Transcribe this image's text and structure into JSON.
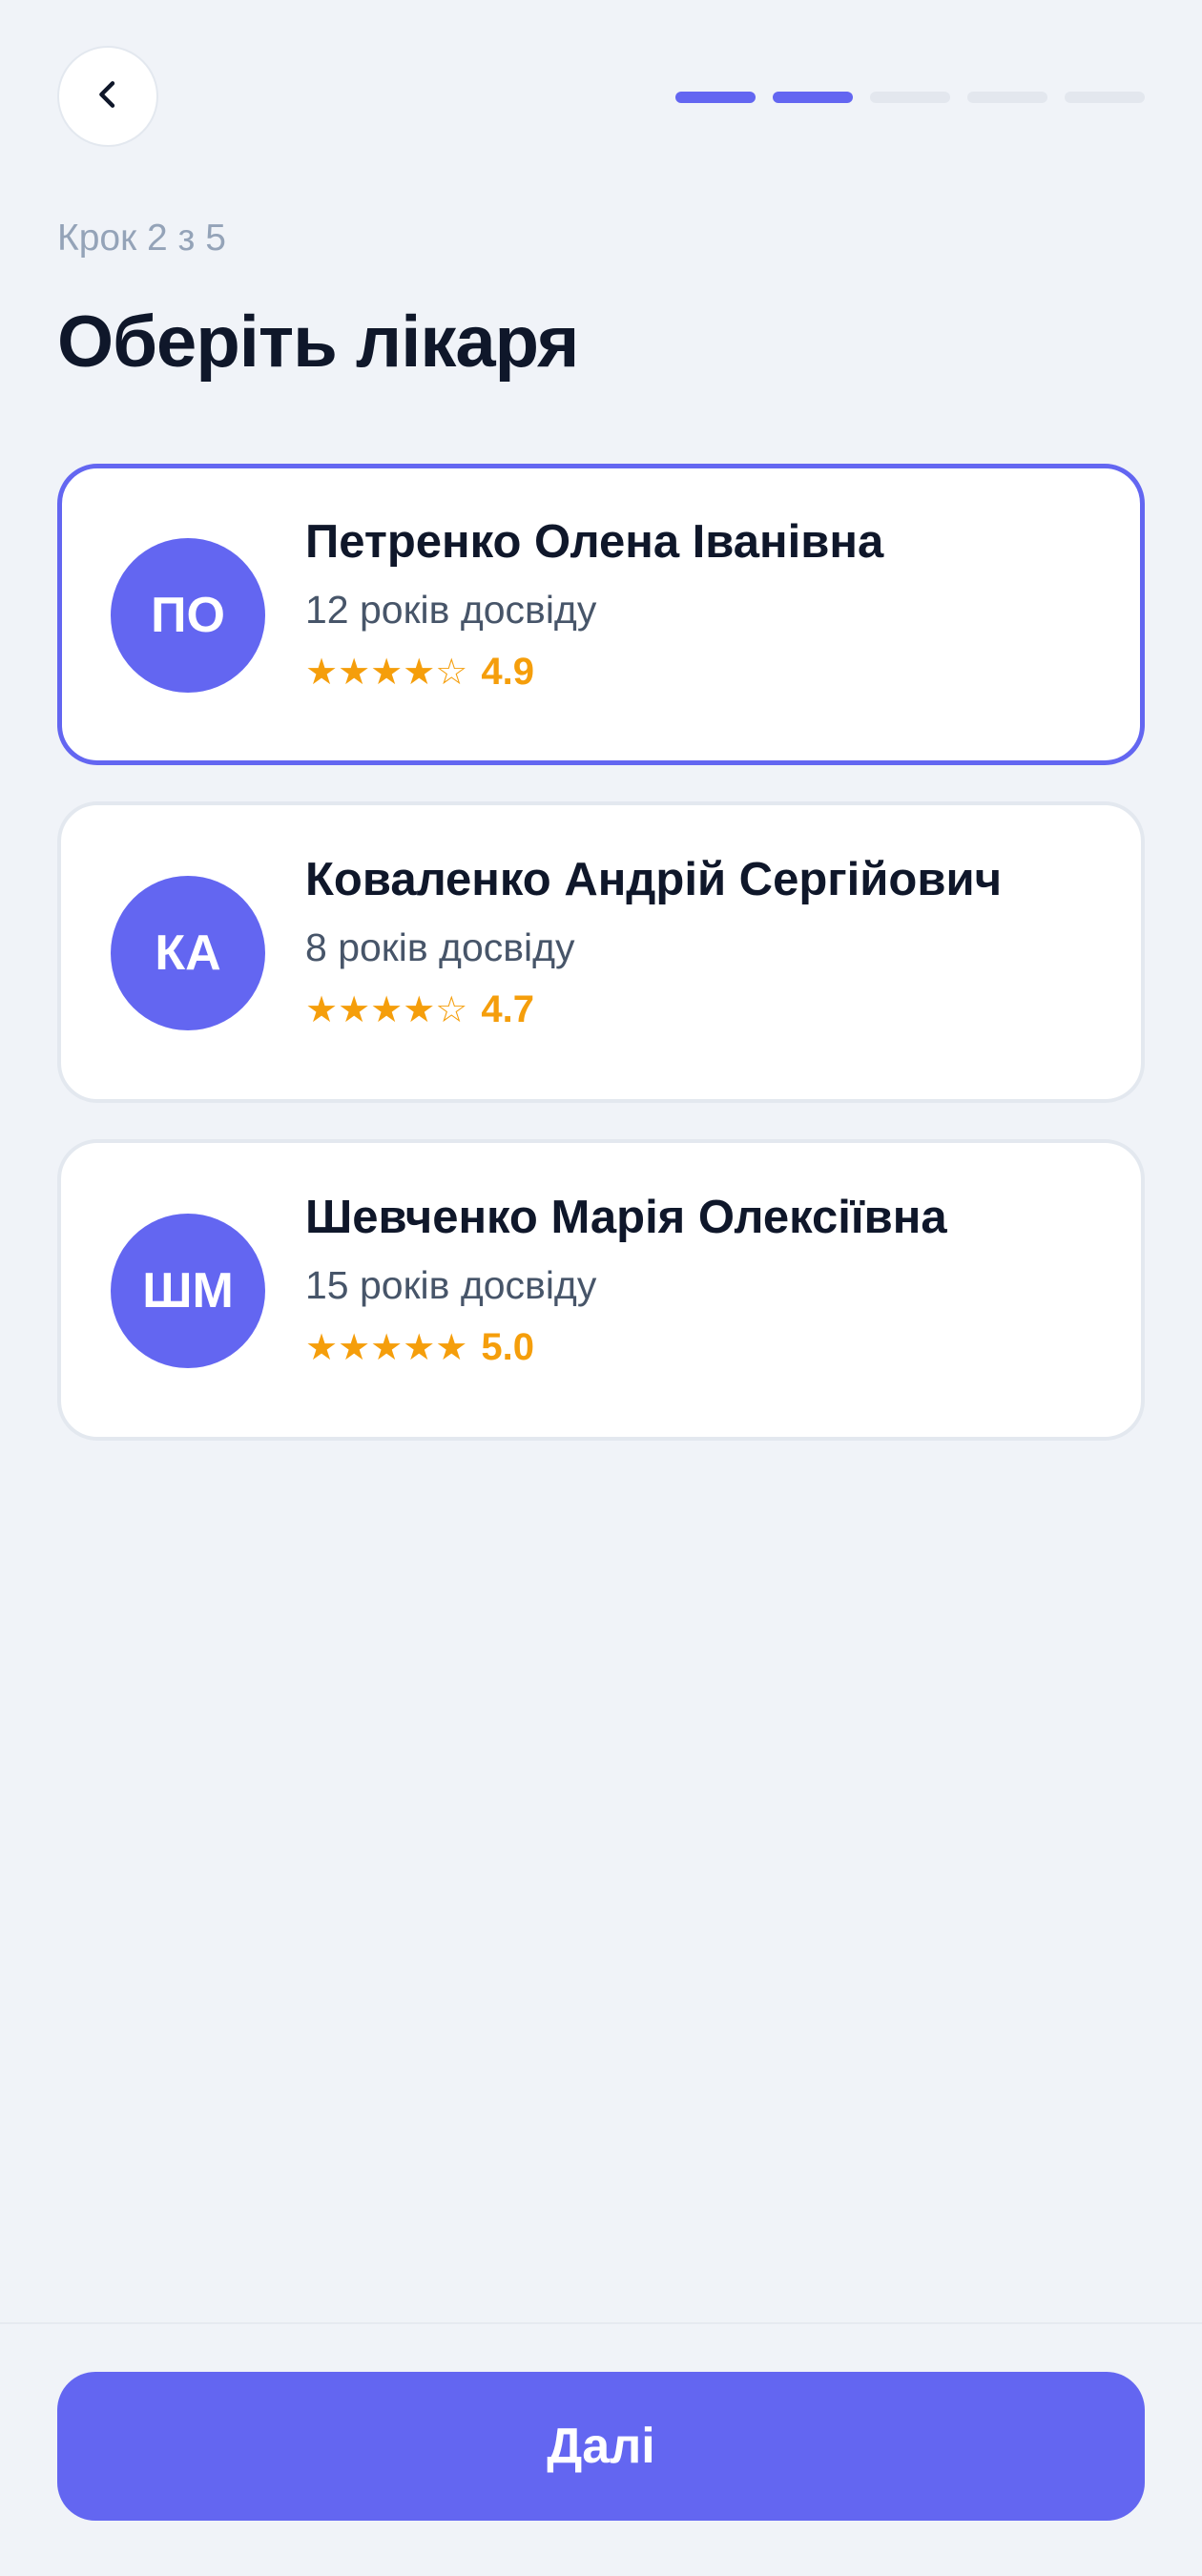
{
  "header": {
    "back_icon": "chevron-left-icon",
    "progress": {
      "current": 2,
      "total": 5
    }
  },
  "step_label": "Крок 2 з 5",
  "title": "Оберіть лікаря",
  "doctors": [
    {
      "initials": "ПО",
      "name": "Петренко Олена Іванівна",
      "experience": "12 років досвіду",
      "stars": "★★★★☆",
      "rating": "4.9",
      "selected": true
    },
    {
      "initials": "КА",
      "name": "Коваленко Андрій Сергійович",
      "experience": "8 років досвіду",
      "stars": "★★★★☆",
      "rating": "4.7",
      "selected": false
    },
    {
      "initials": "ШМ",
      "name": "Шевченко Марія Олексіївна",
      "experience": "15 років досвіду",
      "stars": "★★★★★",
      "rating": "5.0",
      "selected": false
    }
  ],
  "footer": {
    "next_label": "Далі"
  },
  "colors": {
    "accent": "#6366F1",
    "star": "#F59E0B",
    "background": "#F0F3F8"
  }
}
